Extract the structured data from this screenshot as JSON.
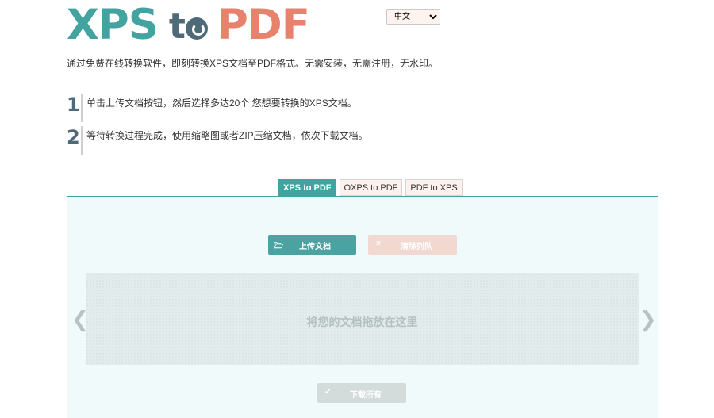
{
  "logo": {
    "part1": "XPS",
    "part2_letter": "t",
    "part3": "PDF"
  },
  "language": {
    "selected": "中文",
    "options": [
      "中文"
    ]
  },
  "intro": "通过免费在线转换软件，即刻转换XPS文档至PDF格式。无需安装，无需注册，无水印。",
  "steps": [
    {
      "number": "1",
      "text": "单击上传文档按钮，然后选择多达20个 您想要转换的XPS文档。"
    },
    {
      "number": "2",
      "text": "等待转换过程完成，使用缩略图或者ZIP压缩文档，依次下载文档。"
    }
  ],
  "tabs": [
    {
      "label": "XPS to PDF",
      "active": true
    },
    {
      "label": "OXPS to PDF",
      "active": false
    },
    {
      "label": "PDF to XPS",
      "active": false
    }
  ],
  "buttons": {
    "upload": "上传文档",
    "clear": "清除列队",
    "download_all": "下载所有"
  },
  "icons": {
    "upload": "folder-open-icon",
    "clear": "x-icon",
    "download": "check-icon",
    "prev": "chevron-left-icon",
    "next": "chevron-right-icon"
  },
  "glyphs": {
    "upload": "🗁",
    "clear": "×",
    "download": "✔",
    "prev": "❮",
    "next": "❯"
  },
  "dropzone": {
    "text": "将您的文档拖放在这里"
  },
  "colors": {
    "accent": "#43a3a0",
    "logo_xps": "#43a3a0",
    "logo_to": "#4e6a78",
    "logo_pdf": "#e8826c"
  }
}
